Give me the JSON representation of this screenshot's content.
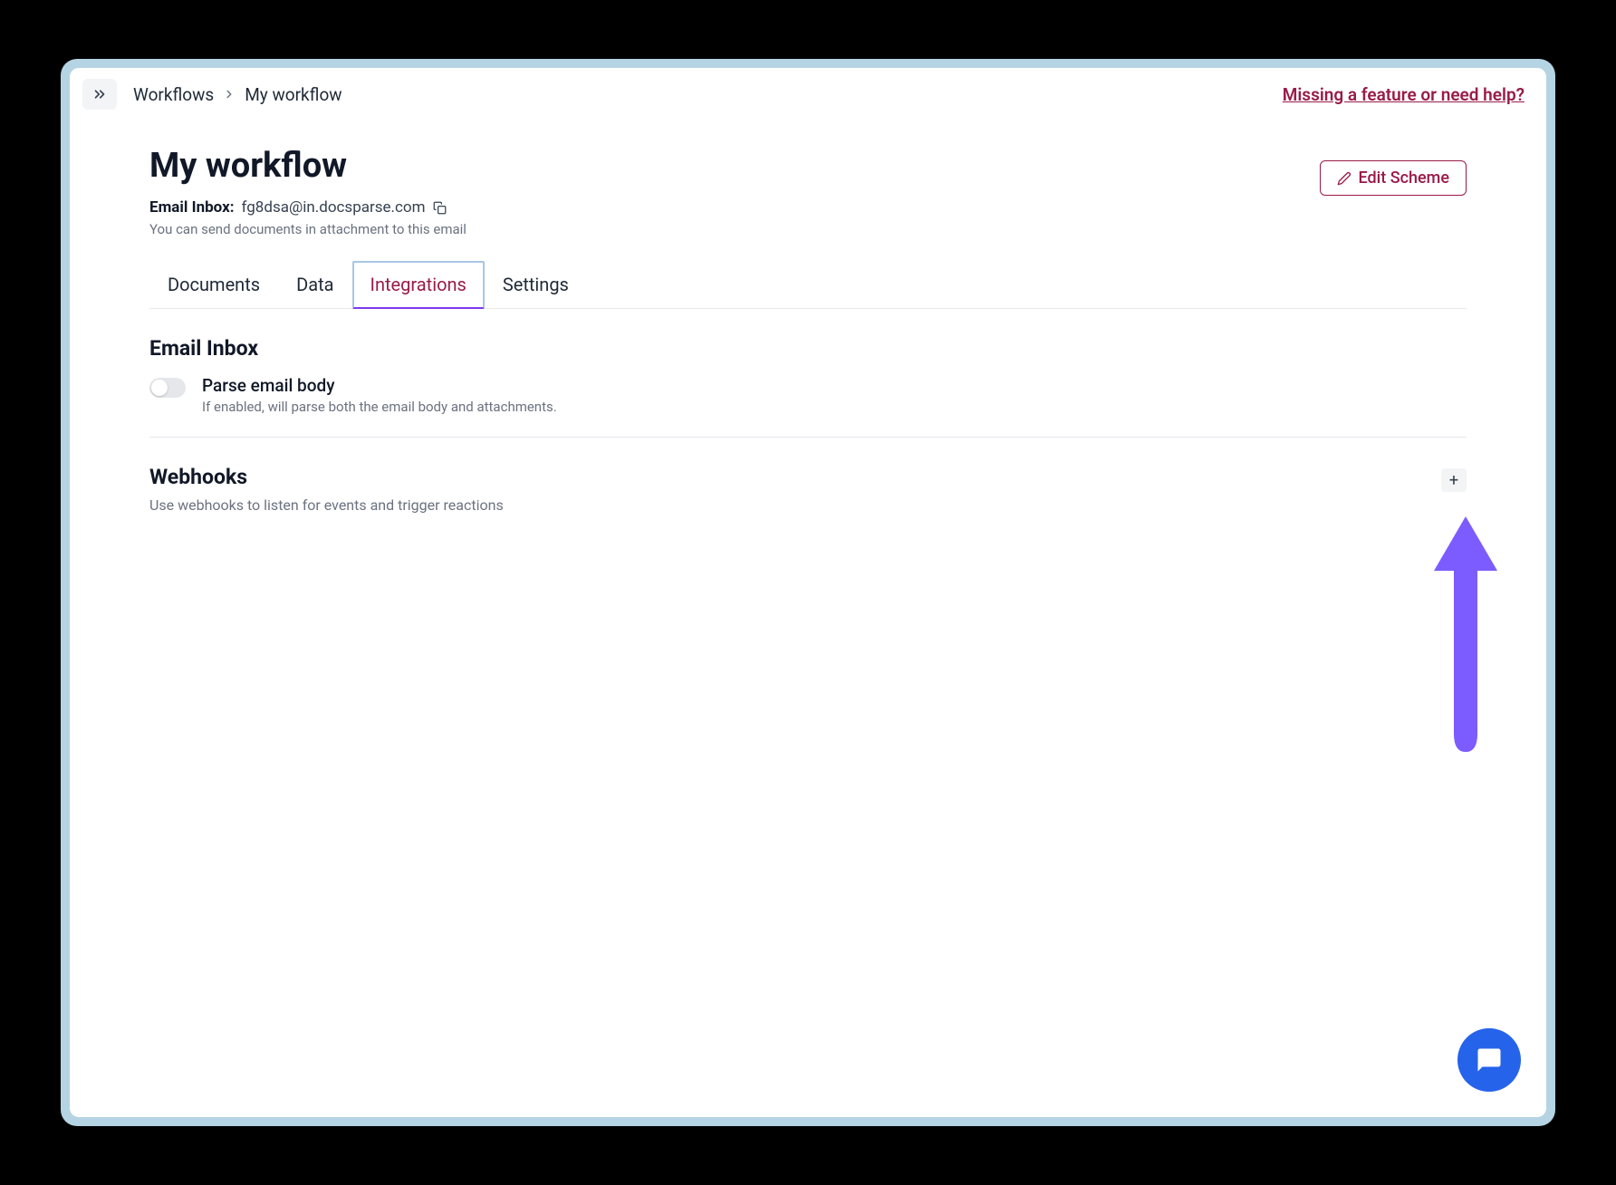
{
  "breadcrumb": {
    "parent": "Workflows",
    "current": "My workflow"
  },
  "help_link": "Missing a feature or need help?",
  "page_title": "My workflow",
  "edit_scheme_label": "Edit Scheme",
  "email_inbox": {
    "label": "Email Inbox:",
    "value": "fg8dsa@in.docsparse.com",
    "hint": "You can send documents in attachment to this email"
  },
  "tabs": [
    {
      "label": "Documents",
      "active": false
    },
    {
      "label": "Data",
      "active": false
    },
    {
      "label": "Integrations",
      "active": true
    },
    {
      "label": "Settings",
      "active": false
    }
  ],
  "email_section": {
    "title": "Email Inbox",
    "toggle_label": "Parse email body",
    "toggle_desc": "If enabled, will parse both the email body and attachments.",
    "toggle_on": false
  },
  "webhooks_section": {
    "title": "Webhooks",
    "desc": "Use webhooks to listen for events and trigger reactions"
  },
  "colors": {
    "accent": "#991b47",
    "frame": "#b5d4e3",
    "arrow": "#7c5cff",
    "chat": "#2563eb"
  }
}
